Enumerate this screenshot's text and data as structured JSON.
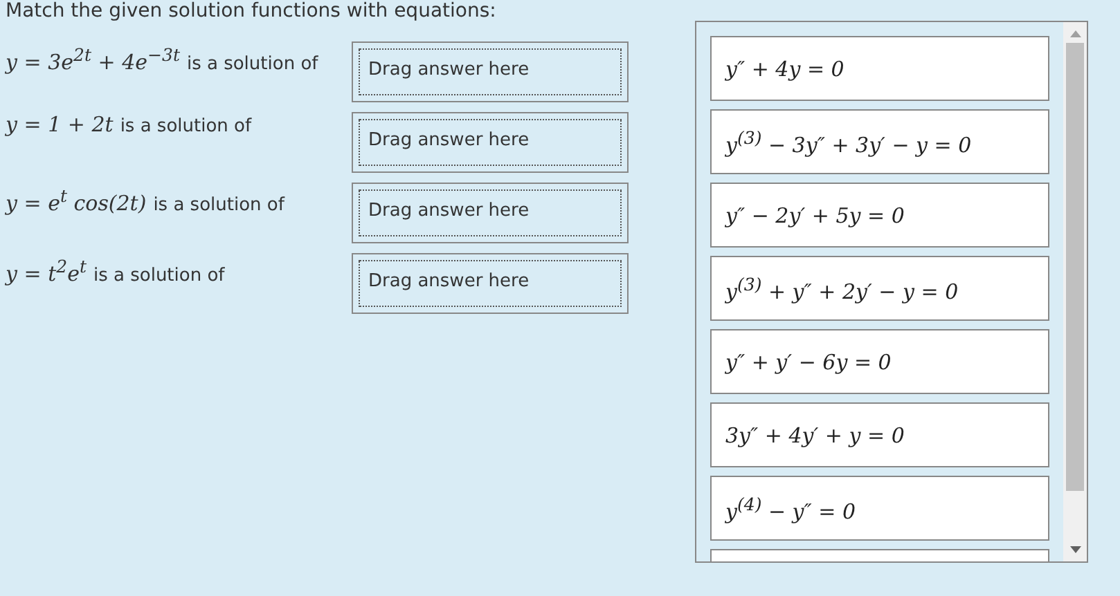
{
  "instruction": "Match the given solution functions with equations:",
  "prompts": [
    {
      "math": "y = 3e$^{2t}$ + 4e$^{−3t}$",
      "text": "is a solution of",
      "drop": "Drag answer here"
    },
    {
      "math": "y = 1 + 2t",
      "text": "is a solution of",
      "drop": "Drag answer here"
    },
    {
      "math": "y = e$^{t}$ cos(2t)",
      "text": "is a solution of",
      "drop": "Drag answer here"
    },
    {
      "math": "y = t$^{2}$e$^{t}$",
      "text": "is a solution of",
      "drop": "Drag answer here"
    }
  ],
  "answers": [
    "y″ + 4y = 0",
    "y$^{(3)}$ − 3y″ + 3y′ − y = 0",
    "y″ − 2y′ + 5y = 0",
    "y$^{(3)}$ + y″ + 2y′ − y = 0",
    "y″ + y′ − 6y = 0",
    "3y″ + 4y′ + y = 0",
    "y$^{(4)}$ − y″ = 0"
  ]
}
